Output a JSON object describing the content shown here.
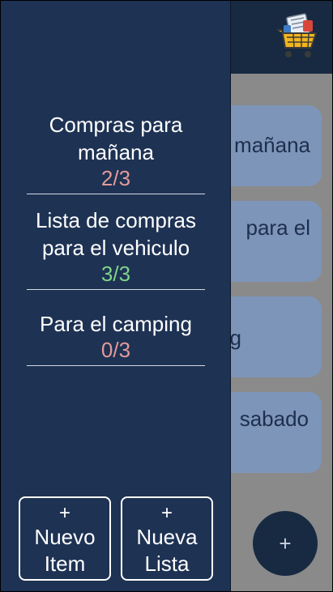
{
  "background": {
    "cards": [
      {
        "label": "mañana"
      },
      {
        "label": "para el"
      },
      {
        "label": "ng"
      },
      {
        "label": "sabado"
      }
    ],
    "fab_label": "+"
  },
  "drawer": {
    "lists": [
      {
        "name": "Compras para mañana",
        "count": "2/3",
        "status": "partial"
      },
      {
        "name": "Lista de compras para el vehiculo",
        "count": "3/3",
        "status": "done"
      },
      {
        "name": "Para el camping",
        "count": "0/3",
        "status": "none"
      }
    ],
    "buttons": {
      "new_item": {
        "plus": "+",
        "label_line1": "Nuevo",
        "label_line2": "Item"
      },
      "new_list": {
        "plus": "+",
        "label_line1": "Nueva",
        "label_line2": "Lista"
      }
    }
  },
  "colors": {
    "drawer_bg": "#1e3253",
    "topbar_bg": "#172a41",
    "card_bg": "#7e95ba",
    "count_partial": "#e39a9a",
    "count_done": "#7fd38a"
  },
  "icons": {
    "cart": "shopping-cart-icon"
  }
}
